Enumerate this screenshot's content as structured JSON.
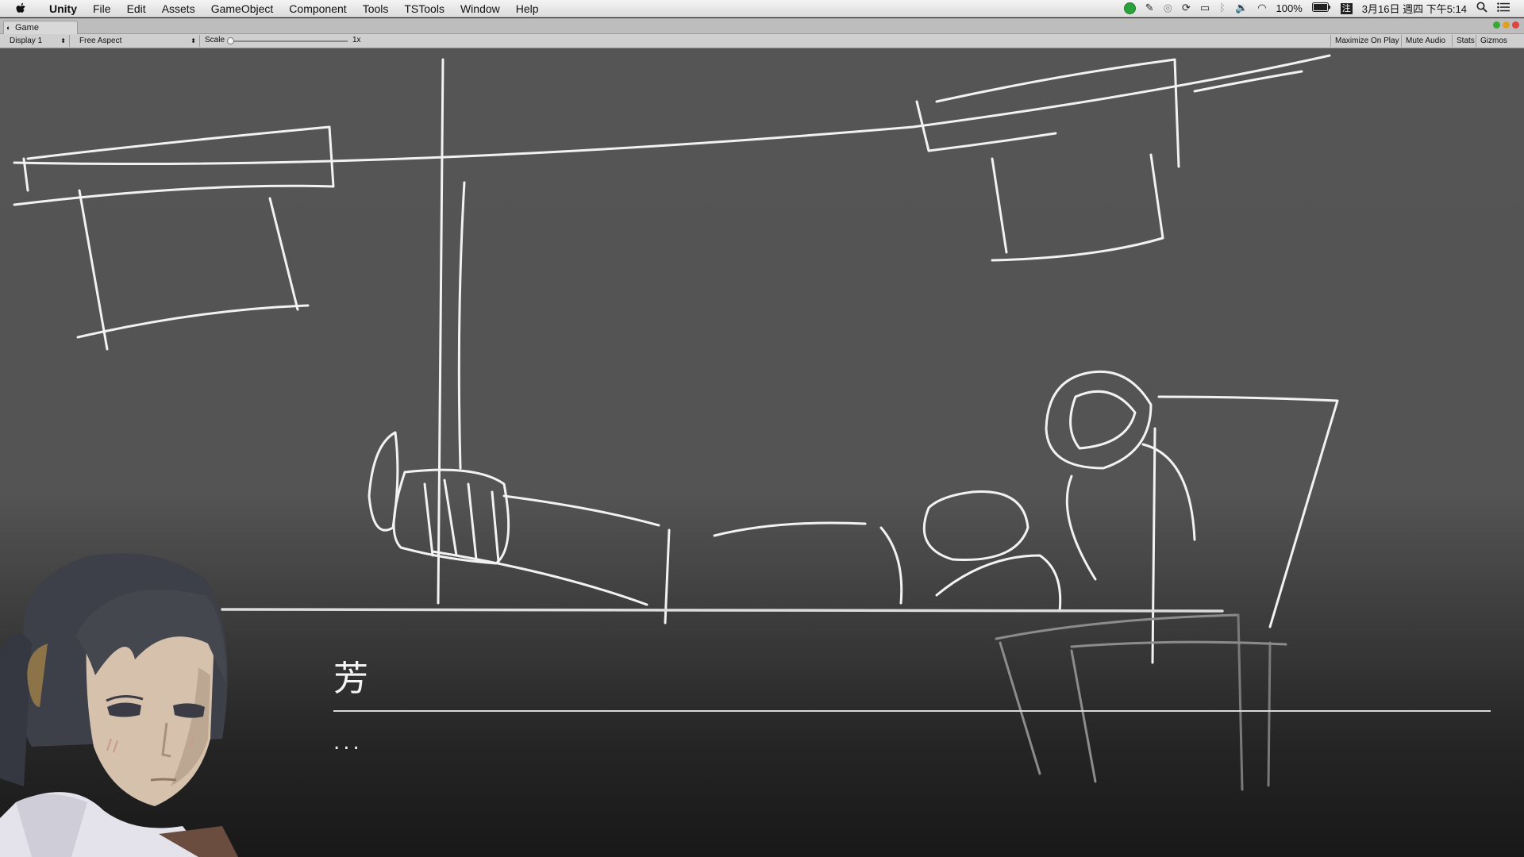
{
  "menubar": {
    "app_name": "Unity",
    "items": [
      "File",
      "Edit",
      "Assets",
      "GameObject",
      "Component",
      "Tools",
      "TSTools",
      "Window",
      "Help"
    ],
    "battery": "100%",
    "datetime": "3月16日 週四 下午5:14"
  },
  "tabs": {
    "game": "Game"
  },
  "toolbar": {
    "display": "Display 1",
    "aspect": "Free Aspect",
    "scale_label": "Scale",
    "scale_value": "1x",
    "maximize_on_play": "Maximize On Play",
    "mute_audio": "Mute Audio",
    "stats": "Stats",
    "gizmos": "Gizmos"
  },
  "dialog": {
    "speaker": "芳",
    "text": "..."
  },
  "colors": {
    "sketch_stroke": "#f2f2f2",
    "game_bg": "#555555",
    "close_red": "#e0443e",
    "min_yellow": "#dea123",
    "max_green": "#37a935"
  }
}
